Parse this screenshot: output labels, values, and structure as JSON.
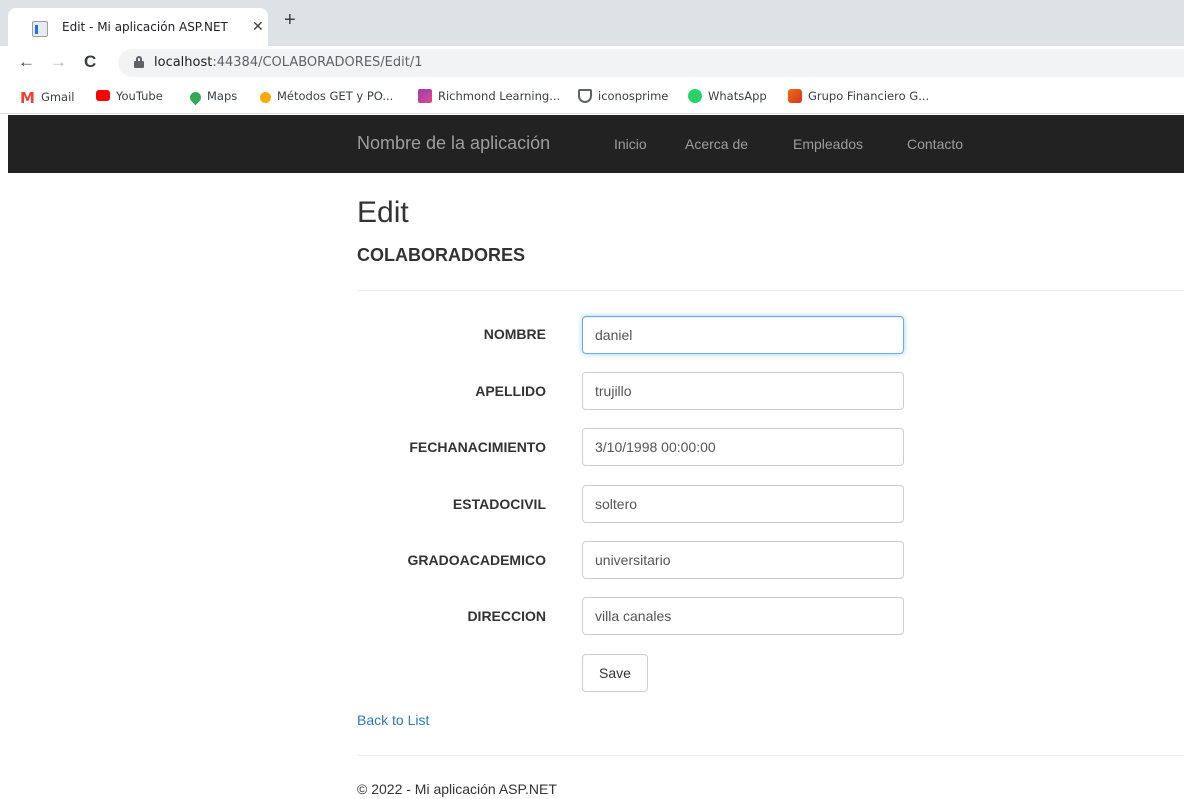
{
  "browser": {
    "tab_title": "Edit - Mi aplicación ASP.NET",
    "url_host": "localhost",
    "url_rest": ":44384/COLABORADORES/Edit/1",
    "bookmarks": [
      {
        "label": "Gmail",
        "icon": "gmail-icon",
        "color": "#ea4335"
      },
      {
        "label": "YouTube",
        "icon": "youtube-icon",
        "color": "#ff0000"
      },
      {
        "label": "Maps",
        "icon": "maps-icon",
        "color": "#34a853"
      },
      {
        "label": "Métodos GET y PO...",
        "icon": "rocket-icon",
        "color": "#f9ab00"
      },
      {
        "label": "Richmond Learning...",
        "icon": "richmond-icon",
        "color": "#8e44ad"
      },
      {
        "label": "iconosprime",
        "icon": "shield-icon",
        "color": "#5f6368"
      },
      {
        "label": "WhatsApp",
        "icon": "whatsapp-icon",
        "color": "#25d366"
      },
      {
        "label": "Grupo Financiero G...",
        "icon": "grupo-icon",
        "color": "#e8710a"
      }
    ]
  },
  "navbar": {
    "brand": "Nombre de la aplicación",
    "links": [
      "Inicio",
      "Acerca de",
      "Empleados",
      "Contacto"
    ]
  },
  "page": {
    "title": "Edit",
    "subtitle": "COLABORADORES",
    "fields": [
      {
        "label": "NOMBRE",
        "value": "daniel"
      },
      {
        "label": "APELLIDO",
        "value": "trujillo"
      },
      {
        "label": "FECHANACIMIENTO",
        "value": "3/10/1998 00:00:00"
      },
      {
        "label": "ESTADOCIVIL",
        "value": "soltero"
      },
      {
        "label": "GRADOACADEMICO",
        "value": "universitario"
      },
      {
        "label": "DIRECCION",
        "value": "villa canales"
      }
    ],
    "save_label": "Save",
    "back_label": "Back to List",
    "footer": "© 2022 - Mi aplicación ASP.NET"
  },
  "colors": {
    "navbar_bg": "#222222",
    "link": "#337ab7",
    "focus_border": "#66afe9"
  }
}
